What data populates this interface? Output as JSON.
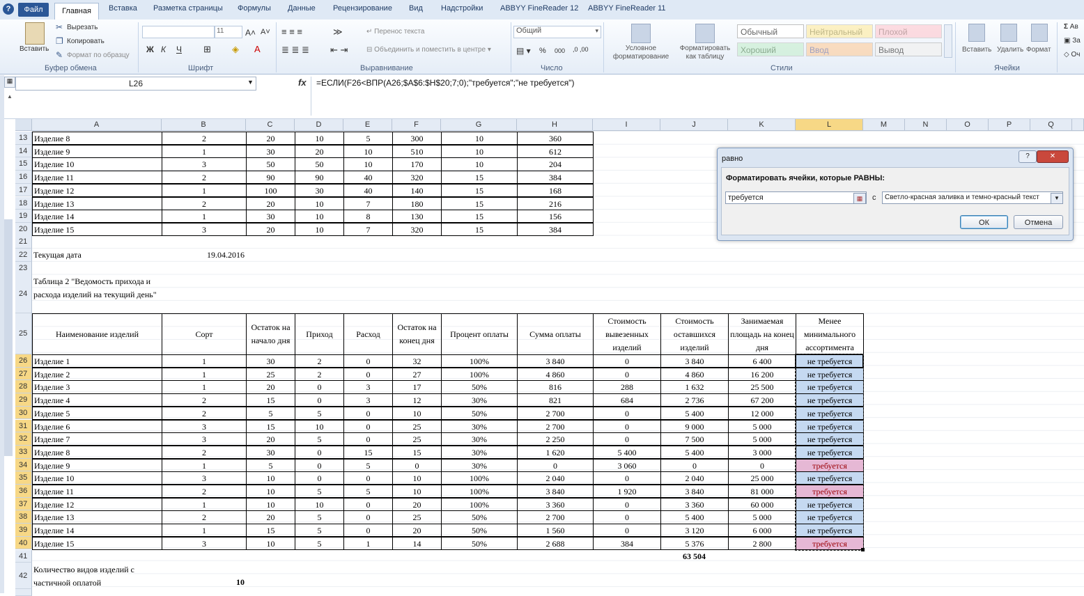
{
  "ribbon_tabs": {
    "file": "Файл",
    "home": "Главная",
    "insert": "Вставка",
    "page_layout": "Разметка страницы",
    "formulas": "Формулы",
    "data": "Данные",
    "review": "Рецензирование",
    "view": "Вид",
    "addins": "Надстройки",
    "abbyy12": "ABBYY FineReader 12",
    "abbyy11": "ABBYY FineReader 11"
  },
  "ribbon": {
    "paste": "Вставить",
    "cut": "Вырезать",
    "copy": "Копировать",
    "format_painter": "Формат по образцу",
    "clipboard_group": "Буфер обмена",
    "font_size": "11",
    "bold": "Ж",
    "italic": "К",
    "underline": "Ч",
    "font_group": "Шрифт",
    "wrap_text": "Перенос текста",
    "merge_center": "Объединить и поместить в центре",
    "alignment_group": "Выравнивание",
    "number_format": "Общий",
    "percent": "%",
    "thousands": "000",
    "number_group": "Число",
    "conditional_formatting": "Условное форматирование",
    "format_as_table": "Форматировать как таблицу",
    "style_normal": "Обычный",
    "style_neutral": "Нейтральный",
    "style_bad": "Плохой",
    "style_good": "Хороший",
    "style_input": "Ввод",
    "style_output": "Вывод",
    "styles_group": "Стили",
    "insert_cells": "Вставить",
    "delete_cells": "Удалить",
    "format_cells": "Формат",
    "cells_group": "Ячейки",
    "autosum": "Ав",
    "fill": "За",
    "clear": "Оч"
  },
  "formula_bar": {
    "name_box": "L26",
    "fx": "fx",
    "formula": "=ЕСЛИ(F26<ВПР(A26;$A$6:$H$20;7;0);\"требуется\";\"не требуется\")"
  },
  "columns": [
    "A",
    "B",
    "C",
    "D",
    "E",
    "F",
    "G",
    "H",
    "I",
    "J",
    "K",
    "L",
    "M",
    "N",
    "O",
    "P",
    "Q"
  ],
  "selected_column": "L",
  "top_rows": [
    {
      "row": "13",
      "name": "Изделие 8",
      "b": "2",
      "c": "20",
      "d": "10",
      "e": "5",
      "f": "300",
      "g": "10",
      "h": "360"
    },
    {
      "row": "14",
      "name": "Изделие 9",
      "b": "1",
      "c": "30",
      "d": "20",
      "e": "10",
      "f": "510",
      "g": "10",
      "h": "612"
    },
    {
      "row": "15",
      "name": "Изделие 10",
      "b": "3",
      "c": "50",
      "d": "50",
      "e": "10",
      "f": "170",
      "g": "10",
      "h": "204"
    },
    {
      "row": "16",
      "name": "Изделие 11",
      "b": "2",
      "c": "90",
      "d": "90",
      "e": "40",
      "f": "320",
      "g": "15",
      "h": "384"
    },
    {
      "row": "17",
      "name": "Изделие 12",
      "b": "1",
      "c": "100",
      "d": "30",
      "e": "40",
      "f": "140",
      "g": "15",
      "h": "168"
    },
    {
      "row": "18",
      "name": "Изделие 13",
      "b": "2",
      "c": "20",
      "d": "10",
      "e": "7",
      "f": "180",
      "g": "15",
      "h": "216"
    },
    {
      "row": "19",
      "name": "Изделие 14",
      "b": "1",
      "c": "30",
      "d": "10",
      "e": "8",
      "f": "130",
      "g": "15",
      "h": "156"
    },
    {
      "row": "20",
      "name": "Изделие 15",
      "b": "3",
      "c": "20",
      "d": "10",
      "e": "7",
      "f": "320",
      "g": "15",
      "h": "384"
    }
  ],
  "row21": "21",
  "row22": {
    "row": "22",
    "label": "Текущая дата",
    "value": "19.04.2016"
  },
  "row23": "23",
  "row24": {
    "row": "24",
    "title": "Таблица 2 \"Ведомость прихода и расхода изделий на текущий день\""
  },
  "headers": {
    "row": "25",
    "a": "Наименование изделий",
    "b": "Сорт",
    "c": "Остаток на начало дня",
    "d": "Приход",
    "e": "Расход",
    "f": "Остаток на конец дня",
    "g": "Процент оплаты",
    "h": "Сумма оплаты",
    "i": "Стоимость вывезенных изделий",
    "j": "Стоимость оставшихся изделий",
    "k": "Занимаемая площадь на конец дня",
    "l": "Менее минимального ассортимента"
  },
  "rows": [
    {
      "row": "26",
      "name": "Изделие 1",
      "b": "1",
      "c": "30",
      "d": "2",
      "e": "0",
      "f": "32",
      "g": "100%",
      "h": "3 840",
      "i": "0",
      "j": "3 840",
      "k": "6 400",
      "l": "не требуется",
      "flag": "blue"
    },
    {
      "row": "27",
      "name": "Изделие 2",
      "b": "1",
      "c": "25",
      "d": "2",
      "e": "0",
      "f": "27",
      "g": "100%",
      "h": "4 860",
      "i": "0",
      "j": "4 860",
      "k": "16 200",
      "l": "не требуется",
      "flag": "blue"
    },
    {
      "row": "28",
      "name": "Изделие 3",
      "b": "1",
      "c": "20",
      "d": "0",
      "e": "3",
      "f": "17",
      "g": "50%",
      "h": "816",
      "i": "288",
      "j": "1 632",
      "k": "25 500",
      "l": "не требуется",
      "flag": "blue"
    },
    {
      "row": "29",
      "name": "Изделие 4",
      "b": "2",
      "c": "15",
      "d": "0",
      "e": "3",
      "f": "12",
      "g": "30%",
      "h": "821",
      "i": "684",
      "j": "2 736",
      "k": "67 200",
      "l": "не требуется",
      "flag": "blue"
    },
    {
      "row": "30",
      "name": "Изделие 5",
      "b": "2",
      "c": "5",
      "d": "5",
      "e": "0",
      "f": "10",
      "g": "50%",
      "h": "2 700",
      "i": "0",
      "j": "5 400",
      "k": "12 000",
      "l": "не требуется",
      "flag": "blue"
    },
    {
      "row": "31",
      "name": "Изделие 6",
      "b": "3",
      "c": "15",
      "d": "10",
      "e": "0",
      "f": "25",
      "g": "30%",
      "h": "2 700",
      "i": "0",
      "j": "9 000",
      "k": "5 000",
      "l": "не требуется",
      "flag": "blue"
    },
    {
      "row": "32",
      "name": "Изделие 7",
      "b": "3",
      "c": "20",
      "d": "5",
      "e": "0",
      "f": "25",
      "g": "30%",
      "h": "2 250",
      "i": "0",
      "j": "7 500",
      "k": "5 000",
      "l": "не требуется",
      "flag": "blue"
    },
    {
      "row": "33",
      "name": "Изделие 8",
      "b": "2",
      "c": "30",
      "d": "0",
      "e": "15",
      "f": "15",
      "g": "30%",
      "h": "1 620",
      "i": "5 400",
      "j": "5 400",
      "k": "3 000",
      "l": "не требуется",
      "flag": "blue"
    },
    {
      "row": "34",
      "name": "Изделие 9",
      "b": "1",
      "c": "5",
      "d": "0",
      "e": "5",
      "f": "0",
      "g": "30%",
      "h": "0",
      "i": "3 060",
      "j": "0",
      "k": "0",
      "l": "требуется",
      "flag": "red"
    },
    {
      "row": "35",
      "name": "Изделие 10",
      "b": "3",
      "c": "10",
      "d": "0",
      "e": "0",
      "f": "10",
      "g": "100%",
      "h": "2 040",
      "i": "0",
      "j": "2 040",
      "k": "25 000",
      "l": "не требуется",
      "flag": "blue"
    },
    {
      "row": "36",
      "name": "Изделие 11",
      "b": "2",
      "c": "10",
      "d": "5",
      "e": "5",
      "f": "10",
      "g": "100%",
      "h": "3 840",
      "i": "1 920",
      "j": "3 840",
      "k": "81 000",
      "l": "требуется",
      "flag": "red"
    },
    {
      "row": "37",
      "name": "Изделие 12",
      "b": "1",
      "c": "10",
      "d": "10",
      "e": "0",
      "f": "20",
      "g": "100%",
      "h": "3 360",
      "i": "0",
      "j": "3 360",
      "k": "60 000",
      "l": "не требуется",
      "flag": "blue"
    },
    {
      "row": "38",
      "name": "Изделие 13",
      "b": "2",
      "c": "20",
      "d": "5",
      "e": "0",
      "f": "25",
      "g": "50%",
      "h": "2 700",
      "i": "0",
      "j": "5 400",
      "k": "5 000",
      "l": "не требуется",
      "flag": "blue"
    },
    {
      "row": "39",
      "name": "Изделие 14",
      "b": "1",
      "c": "15",
      "d": "5",
      "e": "0",
      "f": "20",
      "g": "50%",
      "h": "1 560",
      "i": "0",
      "j": "3 120",
      "k": "6 000",
      "l": "не требуется",
      "flag": "blue"
    },
    {
      "row": "40",
      "name": "Изделие 15",
      "b": "3",
      "c": "10",
      "d": "5",
      "e": "1",
      "f": "14",
      "g": "50%",
      "h": "2 688",
      "i": "384",
      "j": "5 376",
      "k": "2 800",
      "l": "требуется",
      "flag": "red"
    }
  ],
  "row41": {
    "row": "41",
    "total": "63 504"
  },
  "row42": {
    "row": "42",
    "label": "Количество видов изделий с частичной оплатой",
    "value": "10"
  },
  "colors": {
    "blue_fill": "#c5d9f1",
    "red_fill": "#e6b8d5",
    "red_text": "#9c0006",
    "selected_header": "#f7d886"
  },
  "dialog": {
    "title": "равно",
    "help": "?",
    "close": "✕",
    "prompt": "Форматировать ячейки, которые РАВНЫ:",
    "value": "требуется",
    "with": "с",
    "format_option": "Светло-красная заливка и темно-красный текст",
    "ok": "ОК",
    "cancel": "Отмена"
  }
}
